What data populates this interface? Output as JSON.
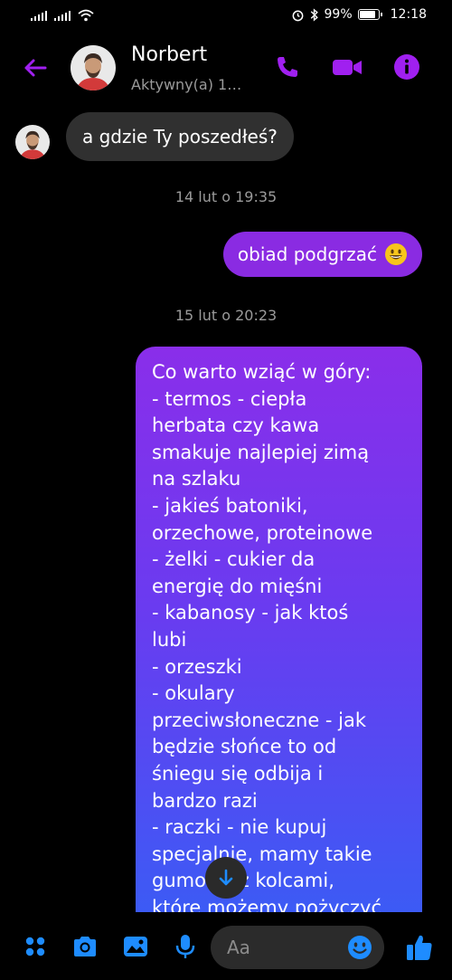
{
  "status_bar": {
    "battery": "99%",
    "time": "12:18"
  },
  "header": {
    "contact_name": "Norbert",
    "status_text": "Aktywny(a) 1…"
  },
  "messages": {
    "incoming_1": "a gdzie Ty poszedłeś?",
    "timestamp_1": "14 lut o 19:35",
    "outgoing_1": "obiad podgrzać",
    "timestamp_2": "15 lut o 20:23",
    "outgoing_2": "Co warto wziąć w góry:\n- termos - ciepła\nherbata czy kawa\nsmakuje najlepiej zimą\nna szlaku\n- jakieś batoniki,\norzechowe, proteinowe\n- żelki - cukier da\nenergię do mięśni\n- kabanosy - jak ktoś\nlubi\n- orzeszki\n- okulary\nprzeciwsłoneczne - jak\nbędzie słońce to od\nśniegu się odbija i\nbardzo razi\n- raczki - nie kupuj\nspecjalnie, mamy takie\ngumowe z kolcami,\nktóre możemy pożyczyć"
  },
  "composer": {
    "placeholder": "Aa"
  },
  "colors": {
    "accent": "#a020f0",
    "bubble_incoming": "#303030",
    "bubble_outgoing_top": "#8a2eea",
    "bubble_outgoing_bottom": "#3a5cf5",
    "composer_icons": "#1e8cff"
  },
  "icons": {
    "back": "arrow-left-icon",
    "call": "phone-icon",
    "video": "video-camera-icon",
    "info": "info-icon",
    "apps": "grid-dots-icon",
    "camera": "camera-icon",
    "gallery": "image-icon",
    "mic": "microphone-icon",
    "emoji": "smiley-icon",
    "like": "thumbs-up-icon",
    "scroll": "arrow-down-icon"
  }
}
